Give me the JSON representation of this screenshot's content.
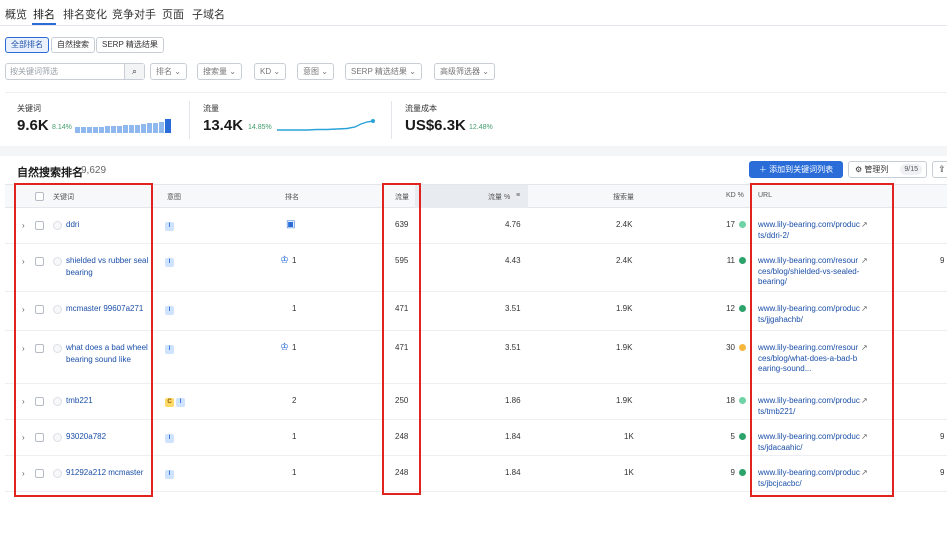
{
  "tabs": [
    "概览",
    "排名",
    "排名变化",
    "竞争对手",
    "页面",
    "子域名"
  ],
  "segments": [
    "全部排名",
    "自然搜索",
    "SERP 精选结果"
  ],
  "filters": {
    "search_placeholder": "按关键词筛选",
    "dropdowns": [
      "排名",
      "搜索量",
      "KD",
      "意图",
      "SERP 精选结果",
      "高级筛选器"
    ]
  },
  "summary": {
    "keywords": {
      "label": "关键词",
      "value": "9.6K",
      "pct": "8.14%"
    },
    "traffic": {
      "label": "流量",
      "value": "13.4K",
      "pct": "14.85%"
    },
    "cost": {
      "label": "流量成本",
      "value": "US$6.3K",
      "pct": "12.48%"
    }
  },
  "section": {
    "title": "自然搜索排名",
    "count": "9,629",
    "add_button": "添加到关键词列表",
    "manage_button": "管理列",
    "manage_count": "9/15"
  },
  "columns": {
    "keyword": "关键词",
    "intent": "意图",
    "position": "排名",
    "traffic": "流量",
    "traffic_pct": "流量 %",
    "volume": "搜索量",
    "kd": "KD %",
    "url": "URL"
  },
  "colors": {
    "kd_green": "#2ca36b",
    "kd_light_green": "#6fd3a5",
    "kd_orange": "#f5b83d",
    "red_box": "#e0231f",
    "accent": "#2a6dd8"
  },
  "rows": [
    {
      "keyword": "ddri",
      "intents": [
        "I"
      ],
      "position": "",
      "serp_icon": "image-pack-icon",
      "traffic": "639",
      "traffic_pct": "4.76",
      "volume": "2.4K",
      "kd": "17",
      "kd_color": "#6fd3a5",
      "url": "www.lily-bearing.com/products/ddri-2/",
      "edge": ""
    },
    {
      "keyword": "shielded vs rubber seal bearing",
      "intents": [
        "I"
      ],
      "position": "1",
      "serp_icon": "crown-icon",
      "traffic": "595",
      "traffic_pct": "4.43",
      "volume": "2.4K",
      "kd": "11",
      "kd_color": "#2ca36b",
      "url": "www.lily-bearing.com/resources/blog/shielded-vs-sealed-bearing/",
      "edge": "9"
    },
    {
      "keyword": "mcmaster 99607a271",
      "intents": [
        "I"
      ],
      "position": "1",
      "serp_icon": "",
      "traffic": "471",
      "traffic_pct": "3.51",
      "volume": "1.9K",
      "kd": "12",
      "kd_color": "#2ca36b",
      "url": "www.lily-bearing.com/products/jjgahachb/",
      "edge": ""
    },
    {
      "keyword": "what does a bad wheel bearing sound like",
      "intents": [
        "I"
      ],
      "position": "1",
      "serp_icon": "crown-icon",
      "traffic": "471",
      "traffic_pct": "3.51",
      "volume": "1.9K",
      "kd": "30",
      "kd_color": "#f5b83d",
      "url": "www.lily-bearing.com/resources/blog/what-does-a-bad-bearing-sound...",
      "edge": ""
    },
    {
      "keyword": "tmb221",
      "intents": [
        "C",
        "I"
      ],
      "position": "2",
      "serp_icon": "",
      "traffic": "250",
      "traffic_pct": "1.86",
      "volume": "1.9K",
      "kd": "18",
      "kd_color": "#6fd3a5",
      "url": "www.lily-bearing.com/products/tmb221/",
      "edge": ""
    },
    {
      "keyword": "93020a782",
      "intents": [
        "I"
      ],
      "position": "1",
      "serp_icon": "",
      "traffic": "248",
      "traffic_pct": "1.84",
      "volume": "1K",
      "kd": "5",
      "kd_color": "#2ca36b",
      "url": "www.lily-bearing.com/products/jdacaahic/",
      "edge": "9"
    },
    {
      "keyword": "91292a212 mcmaster",
      "intents": [
        "I"
      ],
      "position": "1",
      "serp_icon": "",
      "traffic": "248",
      "traffic_pct": "1.84",
      "volume": "1K",
      "kd": "9",
      "kd_color": "#2ca36b",
      "url": "www.lily-bearing.com/products/jbcjcacbc/",
      "edge": "9"
    }
  ]
}
